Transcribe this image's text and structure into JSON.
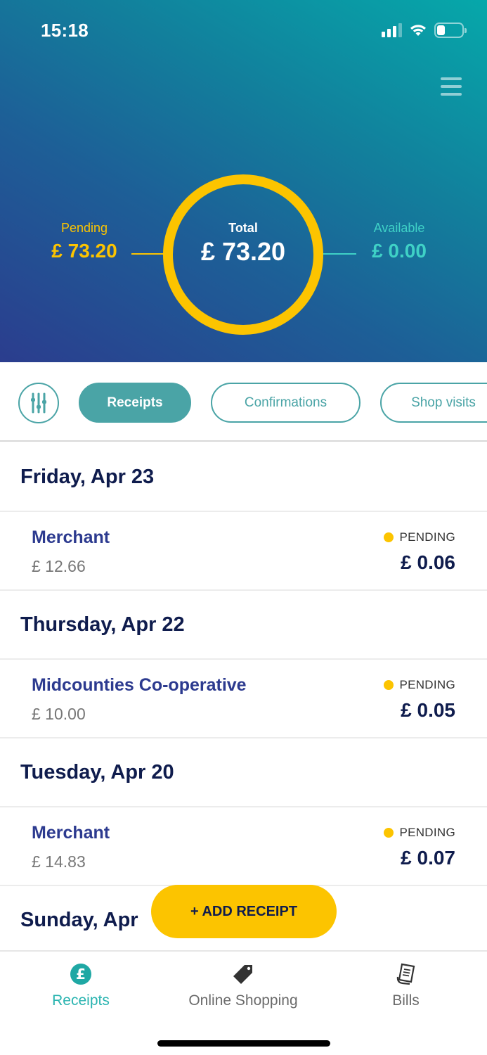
{
  "status_bar": {
    "time": "15:18"
  },
  "header": {
    "menu_icon": "hamburger-menu-icon"
  },
  "summary": {
    "pending": {
      "label": "Pending",
      "value": "£ 73.20"
    },
    "total": {
      "label": "Total",
      "value": "£ 73.20"
    },
    "available": {
      "label": "Available",
      "value": "£ 0.00"
    },
    "colors": {
      "pending": "#fcc400",
      "available": "#3fd1c6",
      "ring": "#fcc400"
    }
  },
  "filters": {
    "filter_icon": "sliders-icon",
    "chips": [
      {
        "label": "Receipts",
        "active": true
      },
      {
        "label": "Confirmations",
        "active": false
      },
      {
        "label": "Shop visits",
        "active": false
      }
    ]
  },
  "groups": [
    {
      "date": "Friday, Apr 23",
      "items": [
        {
          "merchant": "Merchant",
          "spend": "£ 12.66",
          "status": "PENDING",
          "reward": "£ 0.06"
        }
      ]
    },
    {
      "date": "Thursday, Apr 22",
      "items": [
        {
          "merchant": "Midcounties Co-operative",
          "spend": "£ 10.00",
          "status": "PENDING",
          "reward": "£ 0.05"
        }
      ]
    },
    {
      "date": "Tuesday, Apr 20",
      "items": [
        {
          "merchant": "Merchant",
          "spend": "£ 14.83",
          "status": "PENDING",
          "reward": "£ 0.07"
        }
      ]
    },
    {
      "date": "Sunday, Apr",
      "items": []
    }
  ],
  "add_button": {
    "label": "+ ADD RECEIPT"
  },
  "tabbar": {
    "tabs": [
      {
        "label": "Receipts",
        "icon": "pound-coin-icon",
        "active": true
      },
      {
        "label": "Online Shopping",
        "icon": "price-tag-icon",
        "active": false
      },
      {
        "label": "Bills",
        "icon": "bill-receipt-icon",
        "active": false
      }
    ],
    "accent": "#2ab4b0"
  }
}
